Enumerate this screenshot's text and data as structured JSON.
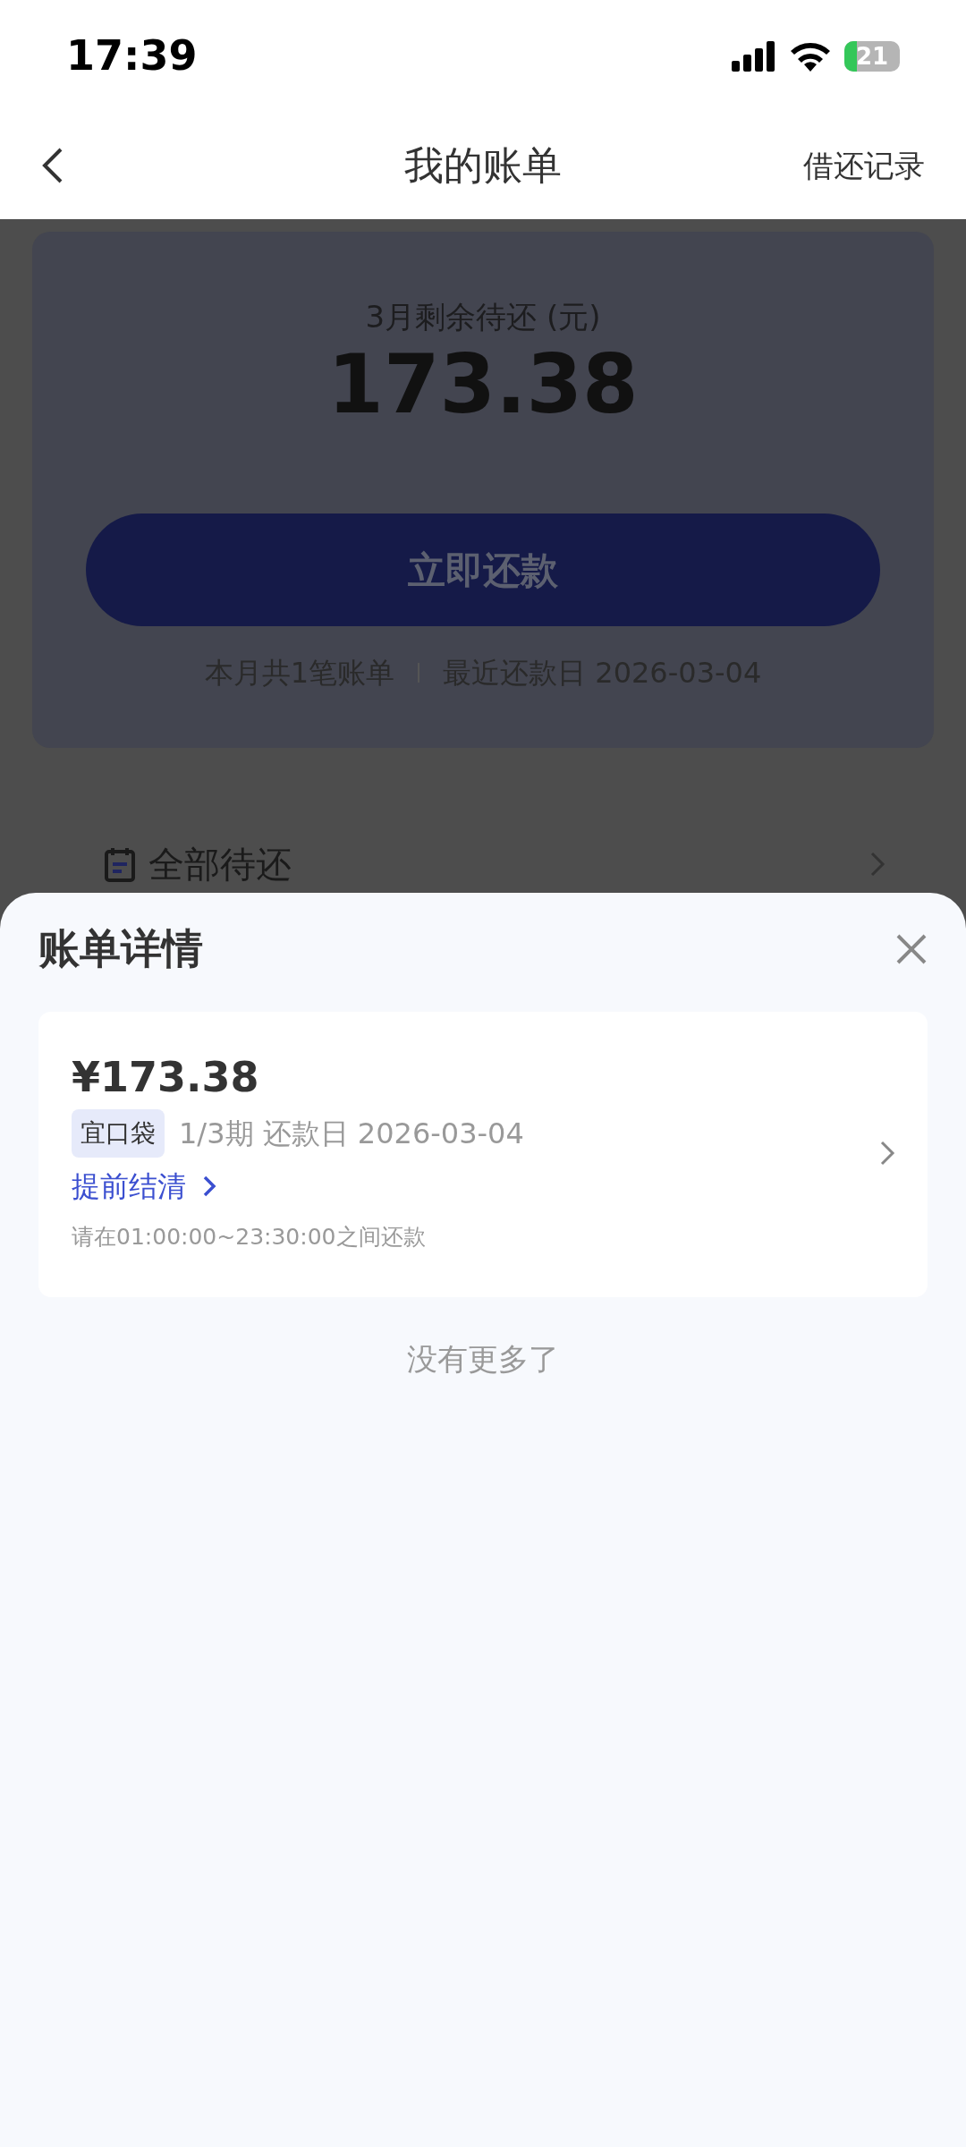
{
  "status_bar": {
    "time": "17:39",
    "battery": "21"
  },
  "header": {
    "title": "我的账单",
    "action": "借还记录"
  },
  "summary": {
    "label": "3月剩余待还 (元)",
    "amount": "173.38",
    "pay_button": "立即还款",
    "bill_count": "本月共1笔账单",
    "due_date": "最近还款日 2026-03-04"
  },
  "menu_items": [
    {
      "label": "全部待还"
    }
  ],
  "sheet": {
    "title": "账单详情",
    "bills": [
      {
        "amount": "¥173.38",
        "tag": "宜口袋",
        "period": "1/3期 还款日 2026-03-04",
        "action": "提前结清",
        "note": "请在01:00:00~23:30:00之间还款"
      }
    ],
    "footer": "没有更多了"
  }
}
